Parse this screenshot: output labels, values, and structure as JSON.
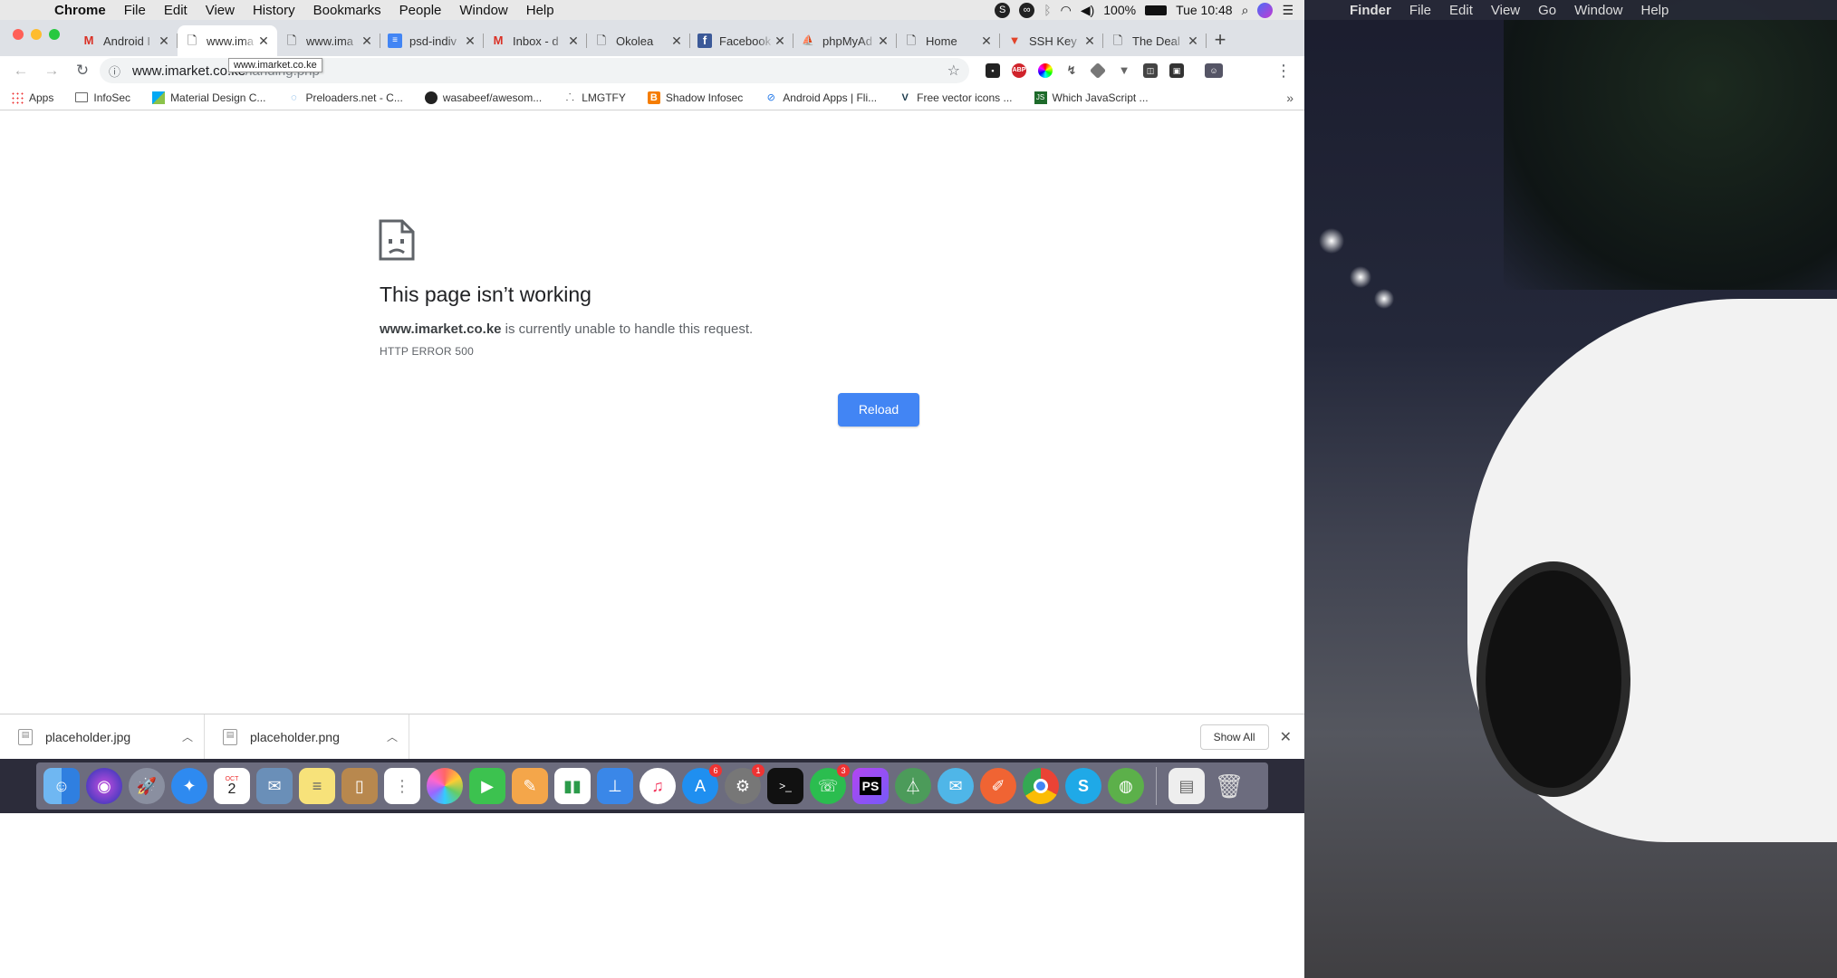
{
  "menubar": {
    "app": "Chrome",
    "items": [
      "File",
      "Edit",
      "View",
      "History",
      "Bookmarks",
      "People",
      "Window",
      "Help"
    ],
    "battery": "100%",
    "clock": "Tue 10:48"
  },
  "finder_menubar": {
    "app": "Finder",
    "items": [
      "File",
      "Edit",
      "View",
      "Go",
      "Window",
      "Help"
    ]
  },
  "tabs": [
    {
      "title": "Android I",
      "icon": "gmail-icon",
      "active": false
    },
    {
      "title": "www.ima",
      "icon": "page-icon",
      "active": true
    },
    {
      "title": "www.ima",
      "icon": "page-icon",
      "active": false
    },
    {
      "title": "psd-indiv",
      "icon": "docs-icon",
      "active": false
    },
    {
      "title": "Inbox - d",
      "icon": "gmail-icon",
      "active": false
    },
    {
      "title": "Okolea",
      "icon": "page-icon",
      "active": false
    },
    {
      "title": "Facebook",
      "icon": "facebook-icon",
      "active": false
    },
    {
      "title": "phpMyAd",
      "icon": "phpmyadmin-icon",
      "active": false
    },
    {
      "title": "Home",
      "icon": "page-icon",
      "active": false
    },
    {
      "title": "SSH Key",
      "icon": "gitlab-icon",
      "active": false
    },
    {
      "title": "The Deal",
      "icon": "page-icon",
      "active": false
    }
  ],
  "tooltip": "www.imarket.co.ke",
  "omnibox": {
    "host": "www.imarket.co.ke",
    "path": "/landing.php"
  },
  "bookmarks": [
    {
      "label": "Apps",
      "icon": "apps-grid-icon"
    },
    {
      "label": "InfoSec",
      "icon": "folder-icon"
    },
    {
      "label": "Material Design C...",
      "icon": "material-icon"
    },
    {
      "label": "Preloaders.net - C...",
      "icon": "preloader-icon"
    },
    {
      "label": "wasabeef/awesom...",
      "icon": "github-icon"
    },
    {
      "label": "LMGTFY",
      "icon": "lmgtfy-icon"
    },
    {
      "label": "Shadow Infosec",
      "icon": "blogger-icon"
    },
    {
      "label": "Android Apps | Fli...",
      "icon": "android-apps-icon"
    },
    {
      "label": "Free vector icons ...",
      "icon": "vector-icon"
    },
    {
      "label": "Which JavaScript ...",
      "icon": "js-icon"
    }
  ],
  "error": {
    "title": "This page isn’t working",
    "host": "www.imarket.co.ke",
    "message": " is currently unable to handle this request.",
    "code": "HTTP ERROR 500",
    "button": "Reload"
  },
  "downloads": {
    "items": [
      "placeholder.jpg",
      "placeholder.png"
    ],
    "show_all": "Show All"
  },
  "dock": {
    "calendar_month": "OCT",
    "calendar_day": "2",
    "badges": {
      "app_store": "6",
      "system_prefs": "1",
      "whatsapp": "3"
    },
    "phpstorm_label": "PS"
  },
  "colors": {
    "accent": "#4285f4",
    "tabstrip": "#dee1e6",
    "close": "#ff5f57",
    "minimize": "#febc2e",
    "zoom": "#28c840"
  }
}
